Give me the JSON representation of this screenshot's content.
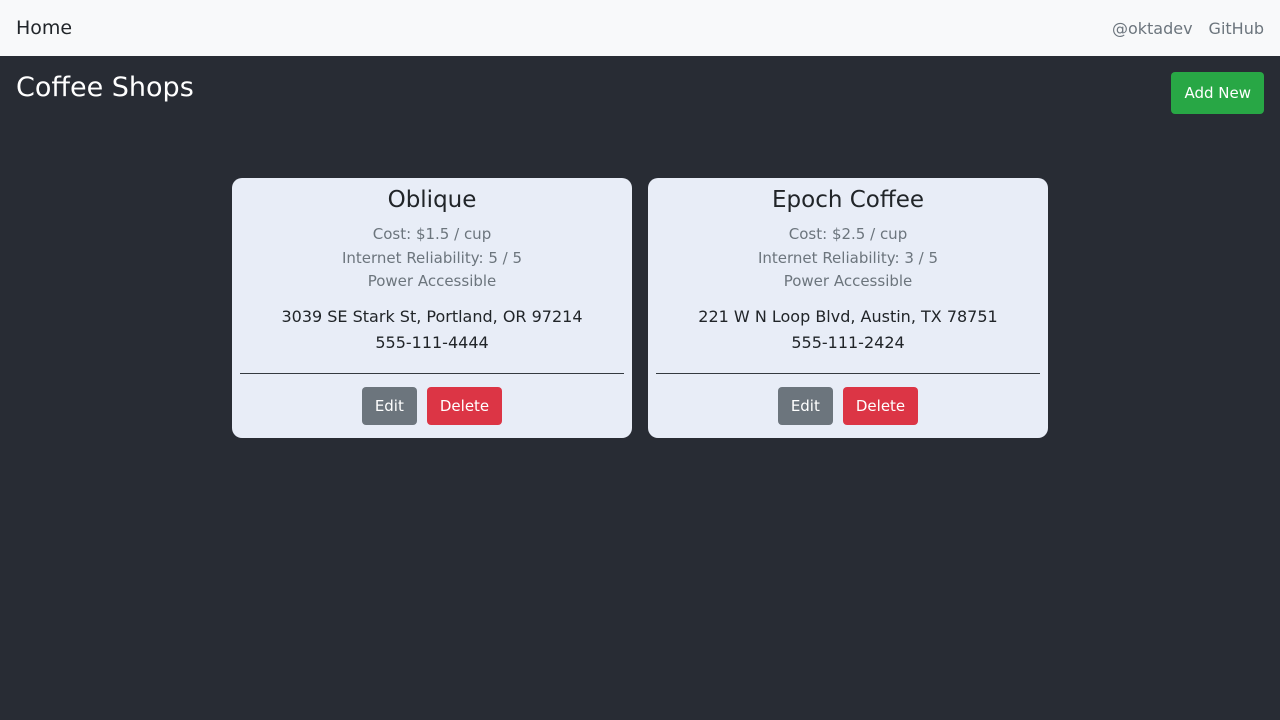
{
  "nav": {
    "brand": "Home",
    "links": [
      "@oktadev",
      "GitHub"
    ]
  },
  "page": {
    "title": "Coffee Shops",
    "add_label": "Add New"
  },
  "shops": [
    {
      "name": "Oblique",
      "cost": "Cost: $1.5 / cup",
      "reliability": "Internet Reliability: 5 / 5",
      "power": "Power Accessible",
      "address": "3039 SE Stark St, Portland, OR 97214",
      "phone": "555-111-4444",
      "edit_label": "Edit",
      "delete_label": "Delete"
    },
    {
      "name": "Epoch Coffee",
      "cost": "Cost: $2.5 / cup",
      "reliability": "Internet Reliability: 3 / 5",
      "power": "Power Accessible",
      "address": "221 W N Loop Blvd, Austin, TX 78751",
      "phone": "555-111-2424",
      "edit_label": "Edit",
      "delete_label": "Delete"
    }
  ],
  "colors": {
    "background": "#282c34",
    "navbar": "#f8f9fa",
    "card": "#e8edf7",
    "add_button": "#28a745",
    "edit_button": "#6c757d",
    "delete_button": "#dc3545"
  }
}
